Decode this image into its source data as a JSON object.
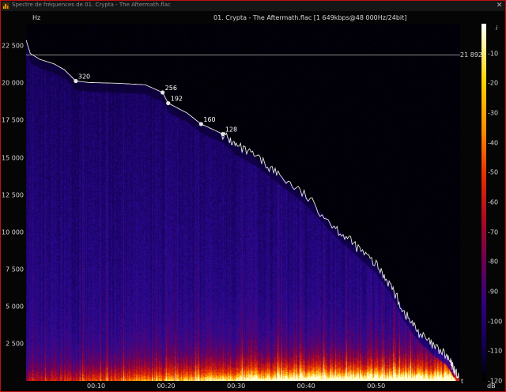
{
  "window": {
    "title": "Spectre de fréquences de 01. Crypta - The Aftermath.flac"
  },
  "header": {
    "file_info": "01. Crypta - The Aftermath.flac [1 649kbps@48 000Hz/24bit]",
    "y_unit": "Hz",
    "x_unit": "t",
    "colorbar_unit": "dB",
    "colorbar_info_icon": "info-icon"
  },
  "colors": {
    "window_border": "#c01010",
    "curve": "#e8e8e8",
    "text": "#d8d8d8"
  },
  "chart_data": {
    "type": "heatmap",
    "ylabel": "Hz",
    "xlabel": "t",
    "ylim": [
      0,
      24000
    ],
    "xlim_seconds": [
      0,
      62
    ],
    "y_ticks": [
      {
        "value": 22500,
        "label": "22 500"
      },
      {
        "value": 20000,
        "label": "20 000"
      },
      {
        "value": 17500,
        "label": "17 500"
      },
      {
        "value": 15000,
        "label": "15 000"
      },
      {
        "value": 12500,
        "label": "12 500"
      },
      {
        "value": 10000,
        "label": "10 000"
      },
      {
        "value": 7500,
        "label": "7 500"
      },
      {
        "value": 5000,
        "label": "5 000"
      },
      {
        "value": 2500,
        "label": "2 500"
      }
    ],
    "x_ticks": [
      {
        "value": 10,
        "label": "00:10"
      },
      {
        "value": 20,
        "label": "00:20"
      },
      {
        "value": 30,
        "label": "00:30"
      },
      {
        "value": 40,
        "label": "00:40"
      },
      {
        "value": 50,
        "label": "00:50"
      }
    ],
    "colorbar_ticks": [
      {
        "value": -10,
        "label": "-10"
      },
      {
        "value": -20,
        "label": "-20"
      },
      {
        "value": -30,
        "label": "-30"
      },
      {
        "value": -40,
        "label": "-40"
      },
      {
        "value": -50,
        "label": "-50"
      },
      {
        "value": -60,
        "label": "-60"
      },
      {
        "value": -70,
        "label": "-70"
      },
      {
        "value": -80,
        "label": "-80"
      },
      {
        "value": -90,
        "label": "-90"
      },
      {
        "value": -100,
        "label": "-100"
      },
      {
        "value": -110,
        "label": "-110"
      },
      {
        "value": -120,
        "label": "-120"
      }
    ],
    "colorbar_range_db": [
      -120,
      0
    ],
    "reference_line": {
      "value": 21892,
      "label": "21 892"
    },
    "markers": [
      {
        "label": "320",
        "t": 7.1,
        "hz": 20150
      },
      {
        "label": "256",
        "t": 19.5,
        "hz": 19380
      },
      {
        "label": "192",
        "t": 20.3,
        "hz": 18660
      },
      {
        "label": "160",
        "t": 25.0,
        "hz": 17260
      },
      {
        "label": "128",
        "t": 28.1,
        "hz": 16590
      }
    ],
    "cutoff_curve": [
      [
        0.0,
        22900
      ],
      [
        0.6,
        22000
      ],
      [
        2.0,
        21600
      ],
      [
        4.0,
        21300
      ],
      [
        5.5,
        20900
      ],
      [
        7.1,
        20150
      ],
      [
        9.0,
        20050
      ],
      [
        13.0,
        20000
      ],
      [
        17.0,
        19900
      ],
      [
        19.5,
        19380
      ],
      [
        20.3,
        18660
      ],
      [
        23.0,
        18000
      ],
      [
        25.0,
        17260
      ],
      [
        28.1,
        16590
      ],
      [
        30.0,
        15800
      ],
      [
        33.0,
        15000
      ],
      [
        36.0,
        13900
      ],
      [
        40.0,
        12400
      ],
      [
        44.0,
        10400
      ],
      [
        47.0,
        9100
      ],
      [
        50.0,
        7800
      ],
      [
        52.0,
        6500
      ],
      [
        54.0,
        4600
      ],
      [
        56.0,
        3300
      ],
      [
        58.0,
        2400
      ],
      [
        60.0,
        1700
      ],
      [
        61.0,
        900
      ],
      [
        61.8,
        200
      ]
    ]
  }
}
